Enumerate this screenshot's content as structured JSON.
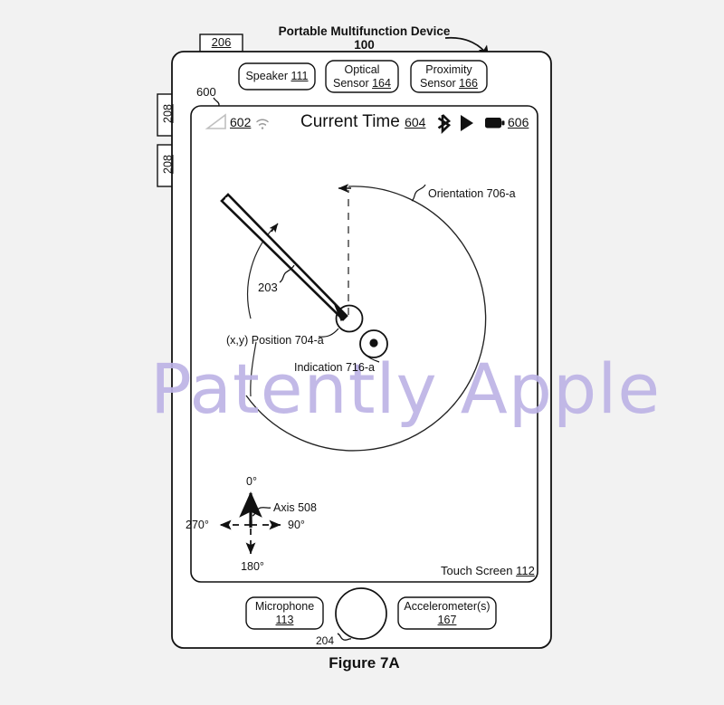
{
  "page": {
    "background_color": "#f2f2f2",
    "ink_color": "#1a1a1a",
    "figure_caption": "Figure 7A"
  },
  "watermark": {
    "text": "Patently Apple",
    "color": "#bdb4e6"
  },
  "header": {
    "title_line1": "Portable Multifunction Device",
    "title_line2": "100",
    "callout_arrow": "curved-arrow-to-device"
  },
  "device": {
    "top_button_label": "206",
    "side_button_upper_label": "208",
    "side_button_lower_label": "208",
    "home_button_label": "204",
    "screen_callout": "600",
    "sensors": [
      {
        "name": "speaker",
        "line1": "Speaker ",
        "ref": "111",
        "multiline": false
      },
      {
        "name": "optical-sensor",
        "line1": "Optical",
        "line2": "Sensor ",
        "ref": "164",
        "multiline": true
      },
      {
        "name": "proximity-sensor",
        "line1": "Proximity",
        "line2": "Sensor ",
        "ref": "166",
        "multiline": true
      }
    ],
    "bottom_components": [
      {
        "name": "microphone",
        "line1": "Microphone",
        "ref": "113"
      },
      {
        "name": "accelerometers",
        "line1": "Accelerometer(s)",
        "ref": "167"
      }
    ],
    "touch_screen": {
      "label": "Touch Screen ",
      "ref": "112"
    }
  },
  "status_bar": {
    "signal_ref": "602",
    "signal_icon": "cellular-signal-icon",
    "wifi_icon": "wifi-icon",
    "time_label": "Current Time ",
    "time_ref": "604",
    "bluetooth_icon": "bluetooth-icon",
    "play_icon": "play-icon",
    "battery_icon": "battery-icon",
    "battery_ref": "606"
  },
  "diagram": {
    "stylus_ref": "203",
    "orientation_label": "Orientation 706-a",
    "position_label": "(x,y) Position 704-a",
    "indication_label": "Indication 716-a",
    "axis_label": "Axis 508",
    "axis_degrees": {
      "up": "0°",
      "right": "90°",
      "down": "180°",
      "left": "270°"
    }
  }
}
